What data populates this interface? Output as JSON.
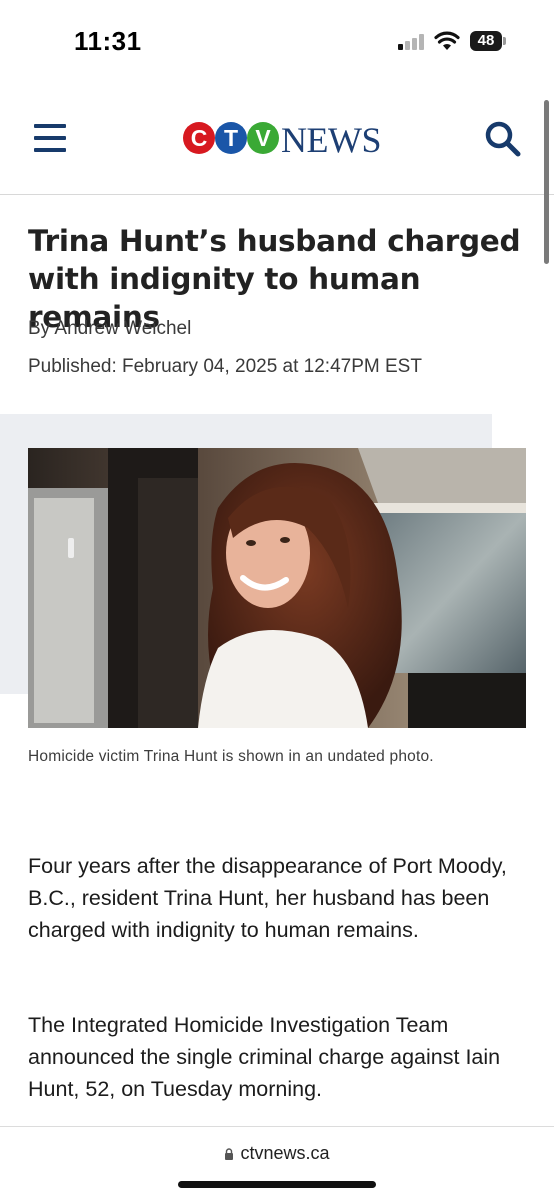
{
  "status_bar": {
    "time": "11:31",
    "battery": "48",
    "icons": [
      "cellular-signal-icon",
      "wifi-icon",
      "battery-icon"
    ]
  },
  "header": {
    "logo_letters": [
      "C",
      "T",
      "V"
    ],
    "logo_word": "NEWS",
    "icons": [
      "menu-icon",
      "search-icon"
    ],
    "brand_colors": {
      "red": "#d71920",
      "blue": "#1a56a8",
      "green": "#3aa935",
      "navy": "#1d3f74"
    }
  },
  "article": {
    "headline": "Trina Hunt’s husband charged with indignity to human remains",
    "byline": "By Andrew Weichel",
    "published": "Published: February 04, 2025 at 12:47PM EST",
    "caption": "Homicide victim Trina Hunt is shown in an undated photo.",
    "paragraphs": [
      "Four years after the disappearance of Port Moody, B.C., resident Trina Hunt, her husband has been charged with indignity to human remains.",
      "The Integrated Homicide Investigation Team announced the single criminal charge against Iain Hunt, 52, on Tuesday morning."
    ]
  },
  "browser": {
    "url": "ctvnews.ca"
  }
}
